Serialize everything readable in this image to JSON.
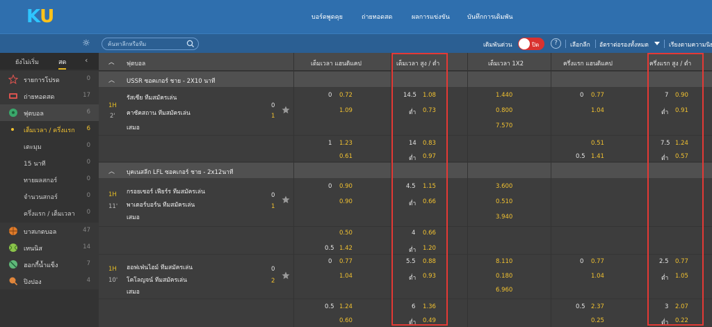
{
  "logo": {
    "k": "K",
    "u": "U"
  },
  "topnav": [
    "บอร์ดพูดคุย",
    "ถ่ายทอดสด",
    "ผลการแข่งขัน",
    "บันทึกการเดิมพัน"
  ],
  "search": {
    "placeholder": "ค้นหาลีกหรือทีม"
  },
  "quick_bet": {
    "label": "เดิมพันด่วน",
    "state": "ปิด"
  },
  "subbar_links": [
    "เลือกลีก",
    "อัตราต่อรองทั้งหมด",
    "เรียงตามความนิยม"
  ],
  "sidebar": {
    "tabs": [
      "ยังไม่เริ่ม",
      "สด"
    ],
    "sports": [
      {
        "label": "รายการโปรด",
        "count": "0",
        "icon": "star-icon"
      },
      {
        "label": "ถ่ายทอดสด",
        "count": "17",
        "icon": "tv-icon"
      },
      {
        "label": "ฟุตบอล",
        "count": "6",
        "icon": "soccer-ball-icon"
      }
    ],
    "soccer_sub": [
      {
        "label": "เต็มเวลา / ครึ่งแรก",
        "count": "6"
      },
      {
        "label": "เตะมุม",
        "count": "0"
      },
      {
        "label": "15 นาที",
        "count": "0"
      },
      {
        "label": "ทายผลสกอร์",
        "count": "0"
      },
      {
        "label": "จำนวนสกอร์",
        "count": "0"
      },
      {
        "label": "ครึ่งแรก / เต็มเวลา",
        "count": "0"
      }
    ],
    "other_sports": [
      {
        "label": "บาสเกตบอล",
        "count": "47",
        "icon": "basketball-icon"
      },
      {
        "label": "เทนนิส",
        "count": "14",
        "icon": "tennis-icon"
      },
      {
        "label": "ฮอกกี้น้ำแข็ง",
        "count": "7",
        "icon": "hockey-icon"
      },
      {
        "label": "ปิงปอง",
        "count": "4",
        "icon": "table-tennis-icon"
      }
    ]
  },
  "table": {
    "headers": [
      "ฟุตบอล",
      "เต็มเวลา แฮนดิแคป",
      "เต็มเวลา สูง / ต่ำ",
      "เต็มเวลา 1X2",
      "ครึ่งแรก แฮนดิแคป",
      "ครึ่งแรก สูง / ต่ำ"
    ]
  },
  "leagues": [
    {
      "name": "USSR ซอคเกอร์ ชาย - 2X10 นาที",
      "matches": [
        {
          "period": "1H",
          "minute": "2'",
          "home": "รัสเซีย ทีมสมัครเล่น",
          "away": "คาซัคสถาน ทีมสมัครเล่น",
          "draw": "เสมอ",
          "home_score": "0",
          "away_score": "1",
          "lines": [
            {
              "hdp_line": "0",
              "hdp_home": "0.72",
              "ou_line": "14.5",
              "ou_over": "1.08",
              "x12": "1.440",
              "h_hdp_line": "0",
              "h_hdp": "0.77",
              "h_ou_line": "7",
              "h_ou": "0.90"
            },
            {
              "hdp_home": "1.09",
              "ou_label": "ต่ำ",
              "ou_under": "0.73",
              "x12": "0.800",
              "h_hdp": "1.04",
              "h_ou_label": "ต่ำ",
              "h_ou": "0.91"
            },
            {
              "x12": "7.570"
            }
          ],
          "extra": [
            {
              "hdp_line": "1",
              "hdp": "1.23",
              "ou_line": "14",
              "ou": "0.83",
              "h_hdp": "0.51",
              "h_ou_line": "7.5",
              "h_ou": "1.24"
            },
            {
              "hdp": "0.61",
              "ou_label": "ต่ำ",
              "ou": "0.97",
              "h_hdp_line": "0.5",
              "h_hdp": "1.41",
              "h_ou_label": "ต่ำ",
              "h_ou": "0.57"
            }
          ]
        }
      ]
    },
    {
      "name": "บุคเนสลีก LFL ซอคเกอร์ ชาย - 2x12นาที",
      "matches": [
        {
          "period": "1H",
          "minute": "11'",
          "home": "กรอยเซอร์ เฟียร์ร ทีมสมัครเล่น",
          "away": "พาเดอร์บอร์น ทีมสมัครเล่น",
          "draw": "เสมอ",
          "home_score": "0",
          "away_score": "1",
          "lines": [
            {
              "hdp_line": "0",
              "hdp_home": "0.90",
              "ou_line": "4.5",
              "ou_over": "1.15",
              "x12": "3.600"
            },
            {
              "hdp_home": "0.90",
              "ou_label": "ต่ำ",
              "ou_under": "0.66",
              "x12": "0.510"
            },
            {
              "x12": "3.940"
            }
          ],
          "extra": [
            {
              "hdp": "0.50",
              "ou_line": "4",
              "ou": "0.66"
            },
            {
              "hdp_line": "0.5",
              "hdp": "1.42",
              "ou_label": "ต่ำ",
              "ou": "1.20"
            }
          ]
        },
        {
          "period": "1H",
          "minute": "10'",
          "home": "ฮอฟเฟ่นไฮม์ ทีมสมัครเล่น",
          "away": "โคโลญจน์ ทีมสมัครเล่น",
          "draw": "เสมอ",
          "home_score": "0",
          "away_score": "2",
          "lines": [
            {
              "hdp_line": "0",
              "hdp_home": "0.77",
              "ou_line": "5.5",
              "ou_over": "0.88",
              "x12": "8.110",
              "h_hdp_line": "0",
              "h_hdp": "0.77",
              "h_ou_line": "2.5",
              "h_ou": "0.77"
            },
            {
              "hdp_home": "1.04",
              "ou_label": "ต่ำ",
              "ou_under": "0.93",
              "x12": "0.180",
              "h_hdp": "1.04",
              "h_ou_label": "ต่ำ",
              "h_ou": "1.05"
            },
            {
              "x12": "6.960"
            }
          ],
          "extra": [
            {
              "hdp_line": "0.5",
              "hdp": "1.24",
              "ou_line": "6",
              "ou": "1.36",
              "h_hdp_line": "0.5",
              "h_hdp": "2.37",
              "h_ou_line": "3",
              "h_ou": "2.07"
            },
            {
              "hdp": "0.60",
              "ou_label": "ต่ำ",
              "ou": "0.49",
              "h_hdp": "0.25",
              "h_ou_label": "ต่ำ",
              "h_ou": "0.22"
            }
          ]
        }
      ]
    }
  ],
  "colors": {
    "accent": "#f2c230",
    "topbar": "#2f6fae",
    "highlight": "#e53935"
  }
}
